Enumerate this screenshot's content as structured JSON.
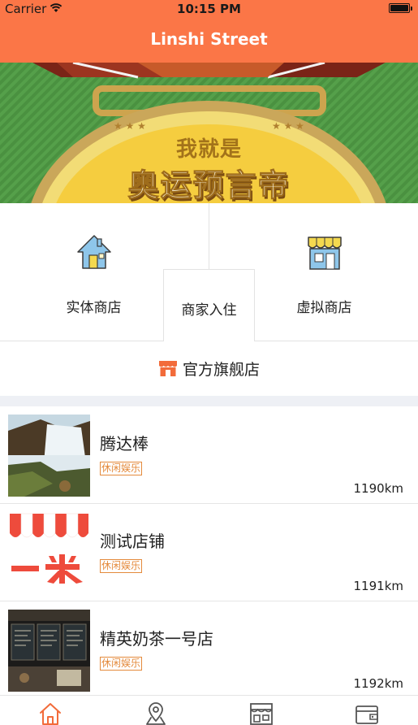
{
  "status_bar": {
    "carrier": "Carrier",
    "time": "10:15 PM"
  },
  "nav": {
    "title": "Linshi Street"
  },
  "banner": {
    "line1": "我就是",
    "line2": "奥运预言帝"
  },
  "categories": {
    "physical_store": {
      "label": "实体商店",
      "icon": "house-icon"
    },
    "merchant_join": {
      "label": "商家入住"
    },
    "virtual_store": {
      "label": "虚拟商店",
      "icon": "storefront-awning-icon"
    }
  },
  "flagship": {
    "label": "官方旗舰店",
    "icon": "store-icon"
  },
  "stores": [
    {
      "name": "腾达棒",
      "tag": "休闲娱乐",
      "distance": "1190km",
      "image": "waterfall-photo"
    },
    {
      "name": "测试店铺",
      "tag": "休闲娱乐",
      "distance": "1191km",
      "image": "awning-logo"
    },
    {
      "name": "精英奶茶一号店",
      "tag": "休闲娱乐",
      "distance": "1192km",
      "image": "tea-shop-photo"
    }
  ],
  "tabs": [
    {
      "name": "home",
      "icon": "home-icon",
      "active": true
    },
    {
      "name": "location",
      "icon": "location-pin-icon",
      "active": false
    },
    {
      "name": "shop",
      "icon": "shop-icon",
      "active": false
    },
    {
      "name": "wallet",
      "icon": "wallet-icon",
      "active": false
    }
  ],
  "colors": {
    "accent": "#fb7647",
    "tag": "#e48a3c",
    "active_tab": "#f26b3a",
    "inactive_tab": "#555555"
  }
}
